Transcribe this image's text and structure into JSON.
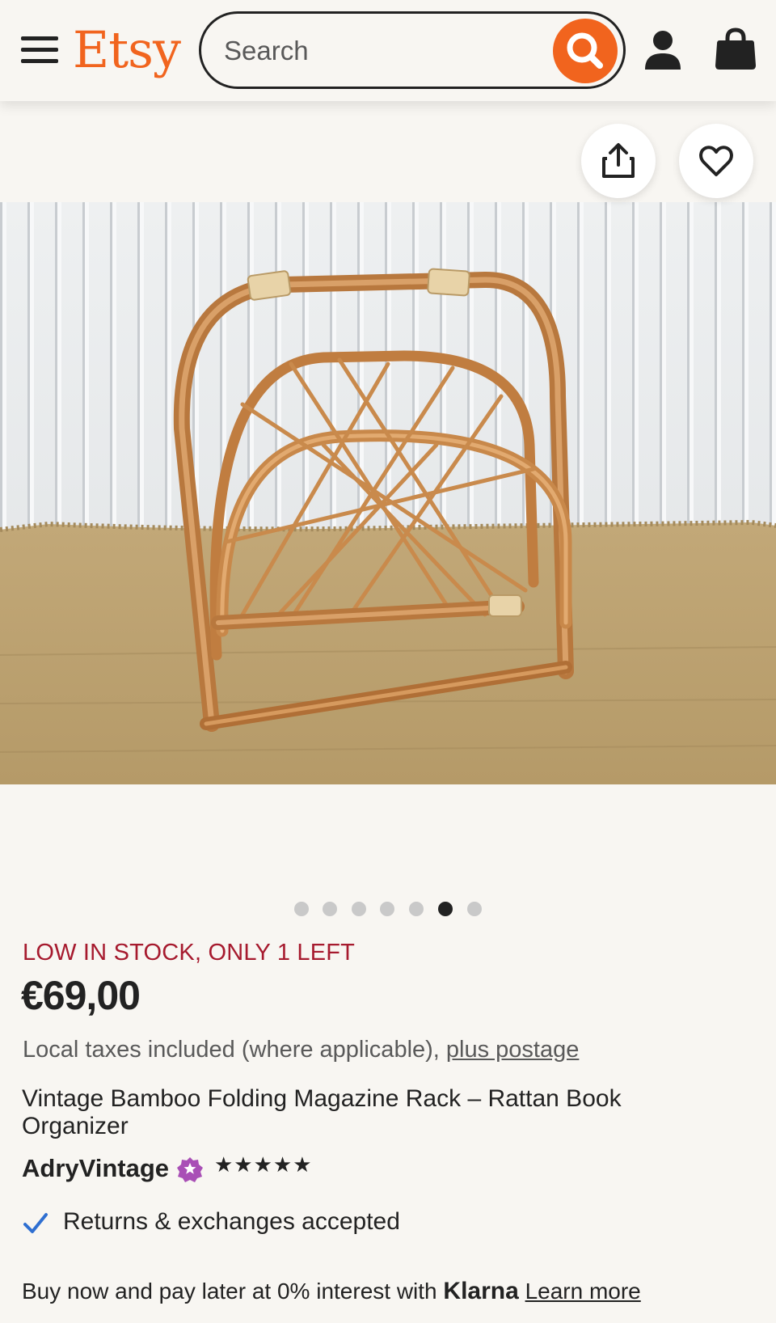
{
  "header": {
    "logo": "Etsy",
    "search_placeholder": "Search",
    "menu_icon": "hamburger-menu-icon",
    "search_icon": "magnifier-icon",
    "user_icon": "user-icon",
    "bag_icon": "shopping-bag-icon"
  },
  "gallery": {
    "share_icon": "share-icon",
    "favorite_icon": "heart-icon",
    "image_count": 7,
    "active_index": 5
  },
  "listing": {
    "stock_text": "LOW IN STOCK, ONLY 1 LEFT",
    "price": "€69,00",
    "tax_text": "Local taxes included (where applicable),",
    "postage_link": "plus postage",
    "title": "Vintage Bamboo Folding Magazine Rack – Rattan Book Organizer",
    "shop_name": "AdryVintage",
    "rating_stars": "★★★★★",
    "rating_value": 5,
    "returns_text": "Returns & exchanges accepted",
    "klarna_prefix": "Buy now and pay later at 0% interest with",
    "klarna_brand": "Klarna",
    "klarna_link": "Learn more"
  },
  "colors": {
    "brand_orange": "#f1641e",
    "stock_red": "#a61a2e",
    "star_seller_purple": "#a94fb6",
    "check_blue": "#2f6fd1"
  }
}
